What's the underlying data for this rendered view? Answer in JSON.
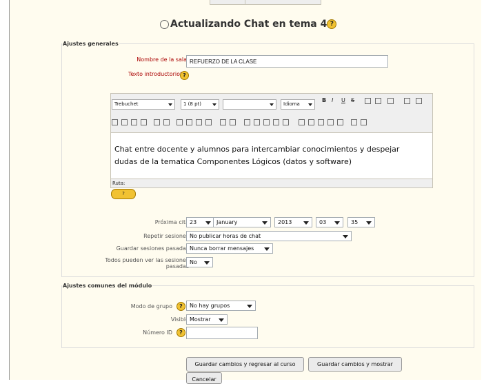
{
  "title": "Actualizando Chat en tema 4",
  "sections": {
    "general": "Ajustes generales",
    "common": "Ajustes comunes del módulo"
  },
  "labels": {
    "room_name": "Nombre de la sala",
    "intro": "Texto introductorio",
    "next_date": "Próxima cita",
    "repeat": "Repetir sesiones",
    "keep": "Guardar sesiones pasadas",
    "everyone_view_1": "Todos pueden ver las sesiones",
    "everyone_view_2": "pasadas",
    "group_mode": "Modo de grupo",
    "visible": "Visible",
    "id_number": "Número ID"
  },
  "fields": {
    "room_name": "REFUERZO DE LA CLASE",
    "next_day": "23",
    "next_month": "January",
    "next_year": "2013",
    "next_hour": "03",
    "next_minute": "35",
    "repeat": "No publicar horas de chat",
    "keep": "Nunca borrar mensajes",
    "everyone_view": "No",
    "group_mode": "No hay grupos",
    "visible": "Mostrar",
    "id_number": ""
  },
  "editor": {
    "font": "Trebuchet",
    "size": "1 (8 pt)",
    "style": "",
    "language": "Idioma",
    "text_line1": "Chat entre docente y alumnos para intercambiar conocimientos y despejar",
    "text_line2": "dudas de la tematica Componentes Lógicos (datos y software)",
    "path": "Ruta:"
  },
  "buttons": {
    "save_return": "Guardar cambios y regresar al curso",
    "save_show": "Guardar cambios y mostrar",
    "cancel": "Cancelar"
  },
  "icons": {
    "help": "?",
    "required": "*",
    "bold": "B",
    "italic": "I",
    "underline": "U",
    "strike": "S"
  },
  "colors": {
    "background": "#fffcef",
    "required": "#a00000",
    "help": "#f1c232"
  }
}
